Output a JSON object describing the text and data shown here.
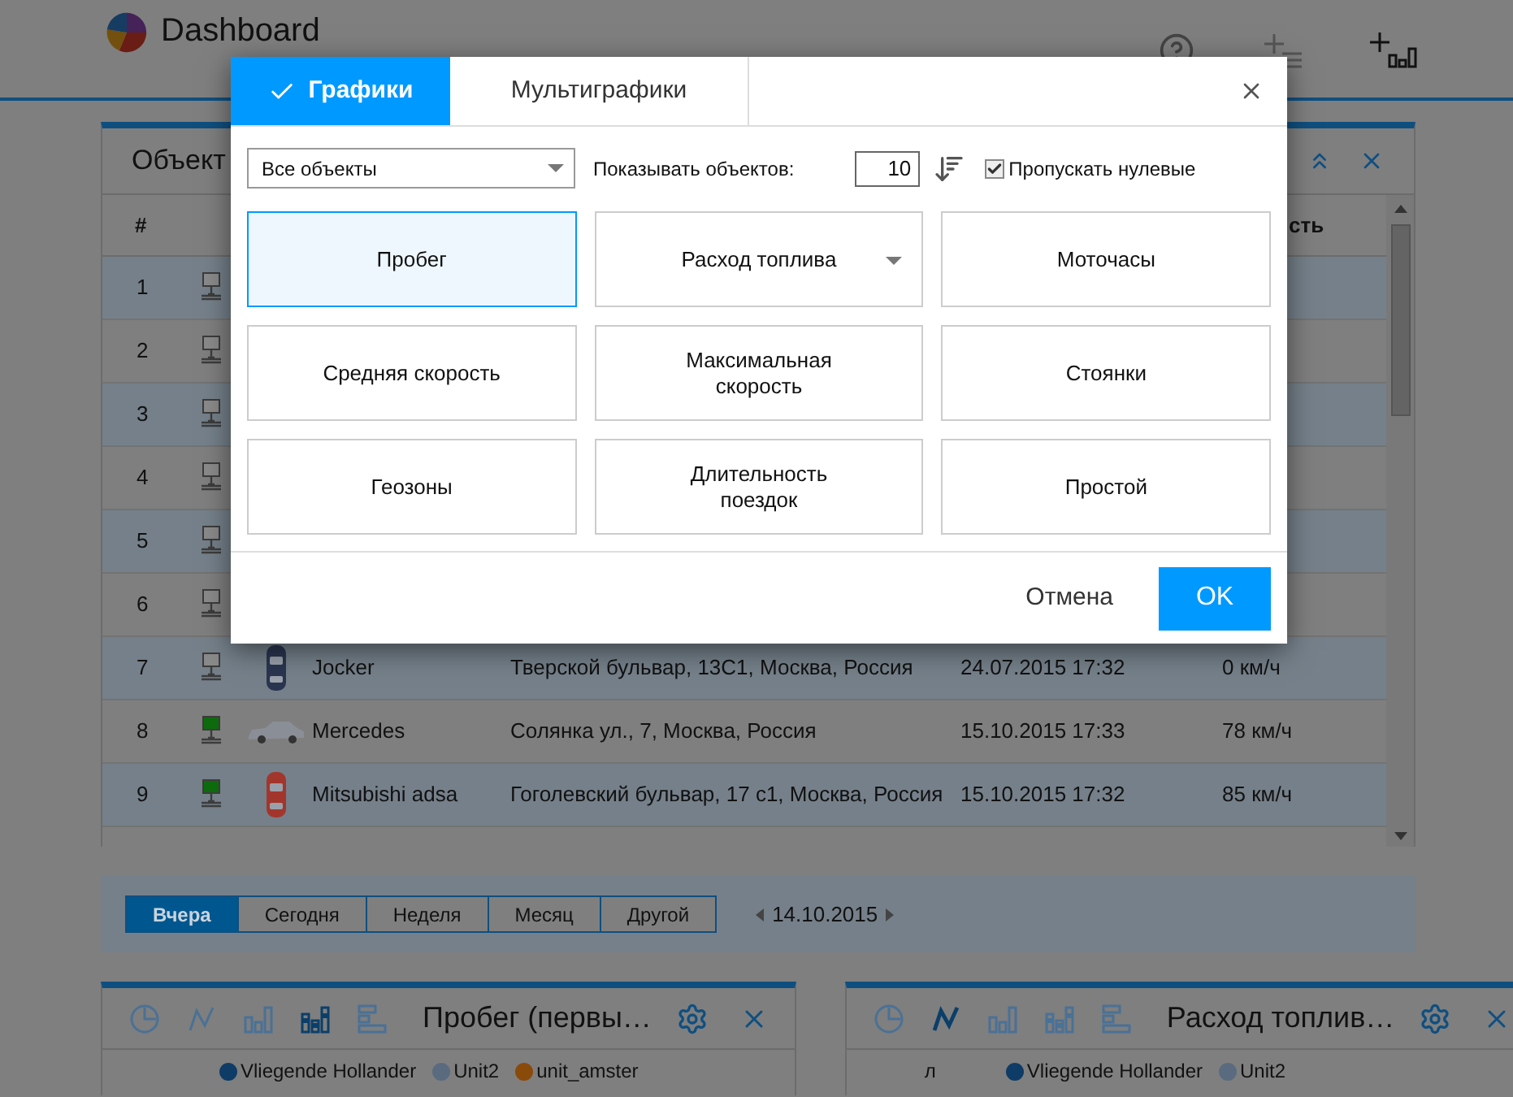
{
  "header": {
    "title": "Dashboard"
  },
  "objects_panel": {
    "title": "Объект",
    "columns": [
      {
        "label": "#"
      },
      {
        "label": "сть"
      }
    ],
    "rows": [
      {
        "number": "1",
        "online": false
      },
      {
        "number": "2",
        "online": false
      },
      {
        "number": "3",
        "online": false
      },
      {
        "number": "4",
        "online": false
      },
      {
        "number": "5",
        "online": false
      },
      {
        "number": "6",
        "online": false
      },
      {
        "number": "7",
        "online": false,
        "kind": "top",
        "color": "#2a3550",
        "name": "Jocker",
        "address": "Тверской бульвар, 13С1, Москва, Россия",
        "time": "24.07.2015 17:32",
        "speed": "0 км/ч"
      },
      {
        "number": "8",
        "online": true,
        "kind": "side",
        "color": "#8a8e96",
        "name": "Mercedes",
        "address": "Солянка ул., 7, Москва, Россия",
        "time": "15.10.2015 17:33",
        "speed": "78 км/ч"
      },
      {
        "number": "9",
        "online": true,
        "kind": "top",
        "color": "#a3362c",
        "name": "Mitsubishi adsa",
        "address": "Гоголевский бульвар, 17 с1, Москва, Россия",
        "time": "15.10.2015 17:32",
        "speed": "85 км/ч"
      }
    ]
  },
  "period_tabs": [
    {
      "label": "Вчера",
      "selected": true
    },
    {
      "label": "Сегодня",
      "selected": false
    },
    {
      "label": "Неделя",
      "selected": false
    },
    {
      "label": "Месяц",
      "selected": false
    },
    {
      "label": "Другой",
      "selected": false
    }
  ],
  "date": "14.10.2015",
  "widgets": [
    {
      "title": "Пробег (первы…",
      "chart_types": [
        {
          "kind": "pie",
          "selected": false
        },
        {
          "kind": "line",
          "selected": false
        },
        {
          "kind": "bar",
          "selected": false
        },
        {
          "kind": "stacked",
          "selected": true
        },
        {
          "kind": "hbar",
          "selected": false
        }
      ],
      "legend": [
        {
          "label": "Vliegende Hollander",
          "color": "#0f3c66"
        },
        {
          "label": "Unit2",
          "color": "#5a6b80"
        },
        {
          "label": "unit_amster",
          "color": "#8a4a0a"
        }
      ]
    },
    {
      "title": "Расход топлив…",
      "y_axis_label": "л",
      "chart_types": [
        {
          "kind": "pie",
          "selected": false
        },
        {
          "kind": "line",
          "selected": true
        },
        {
          "kind": "bar",
          "selected": false
        },
        {
          "kind": "stacked",
          "selected": false
        },
        {
          "kind": "hbar",
          "selected": false
        }
      ],
      "legend": [
        {
          "label": "Vliegende Hollander",
          "color": "#0f3c66"
        },
        {
          "label": "Unit2",
          "color": "#5a6b80"
        }
      ]
    }
  ],
  "dialog": {
    "tabs": [
      {
        "label": "Графики",
        "selected": true
      },
      {
        "label": "Мультиграфики",
        "selected": false
      }
    ],
    "object_select": "Все объекты",
    "count_label": "Показывать объектов:",
    "count": "10",
    "skip_zero": {
      "label": "Пропускать нулевые",
      "checked": true
    },
    "chart_types": [
      {
        "label": "Пробег",
        "selected": true,
        "has_menu": false
      },
      {
        "label": "Расход топлива",
        "selected": false,
        "has_menu": true
      },
      {
        "label": "Моточасы",
        "selected": false,
        "has_menu": false
      },
      {
        "label": "Средняя скорость",
        "selected": false,
        "has_menu": false
      },
      {
        "label": "Максимальная скорость",
        "selected": false,
        "has_menu": false
      },
      {
        "label": "Стоянки",
        "selected": false,
        "has_menu": false
      },
      {
        "label": "Геозоны",
        "selected": false,
        "has_menu": false
      },
      {
        "label": "Длительность поездок",
        "selected": false,
        "has_menu": false
      },
      {
        "label": "Простой",
        "selected": false,
        "has_menu": false
      }
    ],
    "buttons": {
      "cancel": "Отмена",
      "ok": "OK"
    }
  }
}
